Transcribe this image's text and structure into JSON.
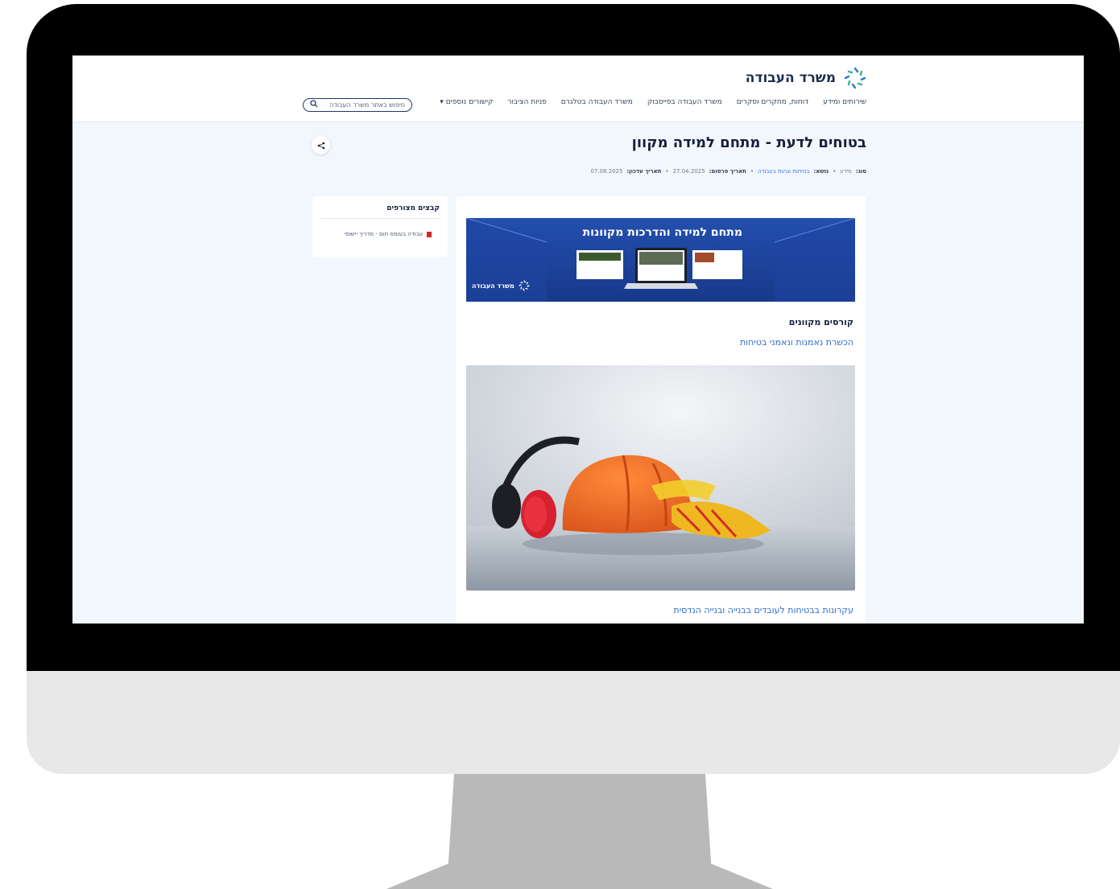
{
  "site": {
    "name": "משרד העבודה"
  },
  "nav": {
    "items": [
      "שירותים ומידע",
      "דוחות, מחקרים וסקרים",
      "משרד העבודה בפייסבוק",
      "משרד העבודה בטלגרם",
      "פניות הציבור"
    ],
    "dropdown": "קישורים נוספים",
    "dropdown_arrow": "▾"
  },
  "search": {
    "placeholder": "חיפוש באתר משרד העבודה",
    "icon": "search-icon"
  },
  "page": {
    "title": "בטוחים לדעת - מתחם למידה מקוון",
    "share_icon": "share-icon"
  },
  "meta": {
    "type_label": "סוג:",
    "type_value": "מידע",
    "topic_label": "נושא:",
    "topic_value": "בטיחות וגהות בעבודה",
    "published_label": "תאריך פרסום:",
    "published_value": "27.04.2025",
    "updated_label": "תאריך עדכון:",
    "updated_value": "07.08.2025",
    "separator": "•"
  },
  "files": {
    "title": "קבצים מצורפים",
    "items": [
      "עבודה בעומס חום - מדריך יישומי"
    ]
  },
  "content": {
    "banner_title": "מתחם למידה והדרכות מקוונות",
    "banner_logo_text": "משרד העבודה",
    "subtitle": "קורסים מקוונים",
    "link1": "הכשרת נאמנות ונאמני בטיחות",
    "link2": "עקרונות בבטיחות לעובדים בבנייה ובנייה הנדסית"
  },
  "colors": {
    "brand_blue": "#1c47a3",
    "link_blue": "#2f6ecc",
    "page_bg": "#f2f6fd"
  }
}
